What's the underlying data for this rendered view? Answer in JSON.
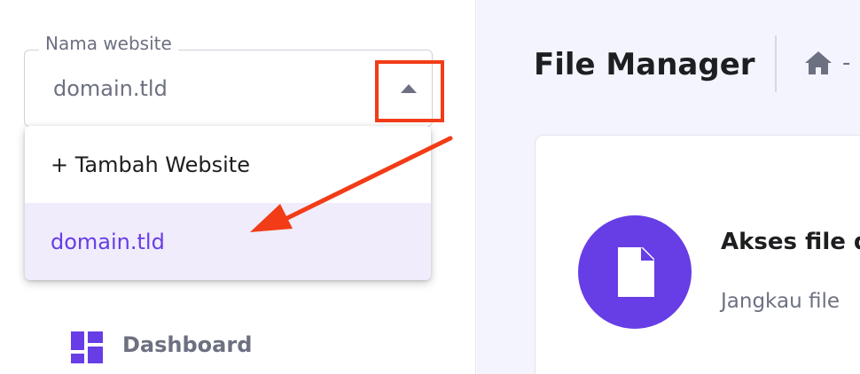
{
  "sidebar": {
    "website_select": {
      "label": "Nama website",
      "value": "domain.tld",
      "options": [
        {
          "label": "+ Tambah Website",
          "highlighted": false
        },
        {
          "label": "domain.tld",
          "highlighted": true
        }
      ]
    },
    "nav": {
      "dashboard_label": "Dashboard",
      "dashboard_icon": "dashboard-grid-icon"
    }
  },
  "main": {
    "page_title": "File Manager",
    "breadcrumb": {
      "home_icon": "home-icon",
      "separator": "-"
    },
    "card": {
      "icon": "file-icon",
      "title": "Akses file d",
      "description": "Jangkau file"
    }
  },
  "colors": {
    "accent": "#673de6",
    "annotation": "#f23c17",
    "selected_option_bg": "#f0ecfc",
    "main_bg": "#f4f4ff"
  }
}
